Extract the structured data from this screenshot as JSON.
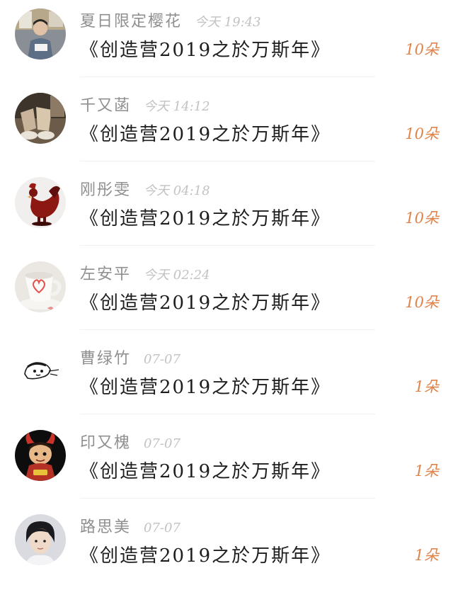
{
  "rows": [
    {
      "username": "夏日限定樱花",
      "time": "今天 19:43",
      "work": "《创造营2019之於万斯年》",
      "count": "10朵",
      "avatar": "boy-at-desk-photo"
    },
    {
      "username": "千又菡",
      "time": "今天 14:12",
      "work": "《创造营2019之於万斯年》",
      "count": "10朵",
      "avatar": "feet-photo"
    },
    {
      "username": "刚彤雯",
      "time": "今天 04:18",
      "work": "《创造营2019之於万斯年》",
      "count": "10朵",
      "avatar": "red-rooster-figurine"
    },
    {
      "username": "左安平",
      "time": "今天 02:24",
      "work": "《创造营2019之於万斯年》",
      "count": "10朵",
      "avatar": "heart-cup-photo"
    },
    {
      "username": "曹绿竹",
      "time": "07-07",
      "work": "《创造营2019之於万斯年》",
      "count": "1朵",
      "avatar": "sketch-face-drawing"
    },
    {
      "username": "印又槐",
      "time": "07-07",
      "work": "《创造营2019之於万斯年》",
      "count": "1朵",
      "avatar": "cartoon-demon-character"
    },
    {
      "username": "路思美",
      "time": "07-07",
      "work": "《创造营2019之於万斯年》",
      "count": "1朵",
      "avatar": "young-man-portrait"
    }
  ],
  "colors": {
    "username": "#8f8f8f",
    "time": "#c2c2c2",
    "work": "#1e1e1e",
    "count": "#e0834c"
  }
}
